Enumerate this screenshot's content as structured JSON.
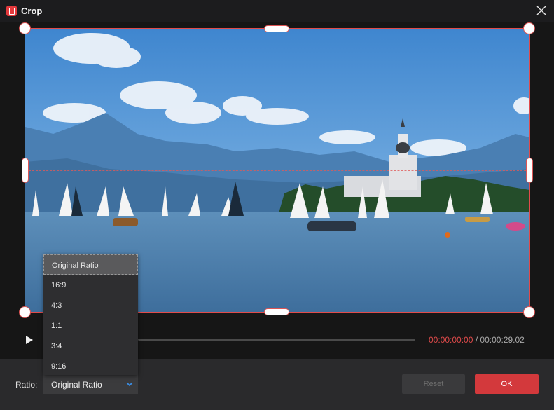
{
  "window": {
    "title": "Crop",
    "app_icon": "app-logo-icon",
    "close_icon": "close-icon"
  },
  "player": {
    "current_time": "00:00:00:00",
    "separator": " / ",
    "total_time": "00:00:29.02",
    "play_icon": "play-icon",
    "progress": 0.0
  },
  "ratio": {
    "label": "Ratio:",
    "selected": "Original Ratio",
    "options": [
      "Original Ratio",
      "16:9",
      "4:3",
      "1:1",
      "3:4",
      "9:16"
    ]
  },
  "buttons": {
    "reset": "Reset",
    "ok": "OK"
  },
  "colors": {
    "accent": "#e14b4b",
    "ok_button": "#d3393c",
    "background": "#1c1c1e"
  }
}
